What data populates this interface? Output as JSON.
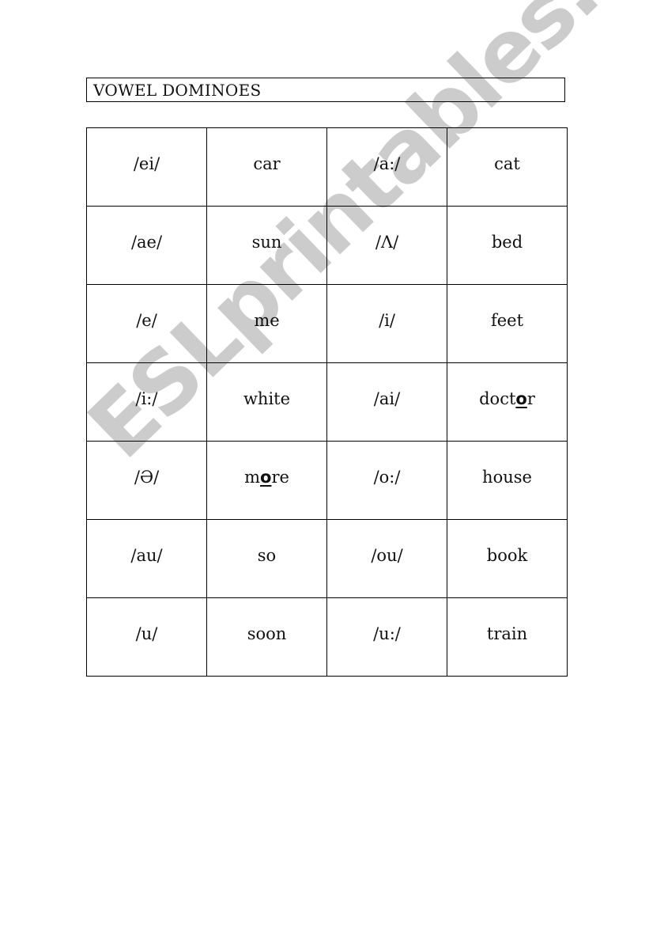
{
  "title": "VOWEL DOMINOES",
  "watermark": "ESLprintables.com",
  "grid": {
    "rows": [
      [
        {
          "text": "/ei/"
        },
        {
          "text": "car"
        },
        {
          "text": "/a:/"
        },
        {
          "text": "cat"
        }
      ],
      [
        {
          "text": "/ae/"
        },
        {
          "text": "sun"
        },
        {
          "text": "/Λ/"
        },
        {
          "text": "bed"
        }
      ],
      [
        {
          "text": "/e/"
        },
        {
          "text": "me"
        },
        {
          "text": "/i/"
        },
        {
          "text": "feet"
        }
      ],
      [
        {
          "text": "/i:/"
        },
        {
          "text": "white"
        },
        {
          "text": "/ai/"
        },
        {
          "text": "doctor",
          "pre": "doct",
          "hl": "o",
          "post": "r"
        }
      ],
      [
        {
          "text": "/Ə/"
        },
        {
          "text": "more",
          "pre": "m",
          "hl": "o",
          "post": "re"
        },
        {
          "text": "/o:/"
        },
        {
          "text": "house"
        }
      ],
      [
        {
          "text": "/au/"
        },
        {
          "text": "so"
        },
        {
          "text": "/ou/"
        },
        {
          "text": "book"
        }
      ],
      [
        {
          "text": "/u/"
        },
        {
          "text": "soon"
        },
        {
          "text": "/u:/"
        },
        {
          "text": "train"
        }
      ]
    ]
  }
}
